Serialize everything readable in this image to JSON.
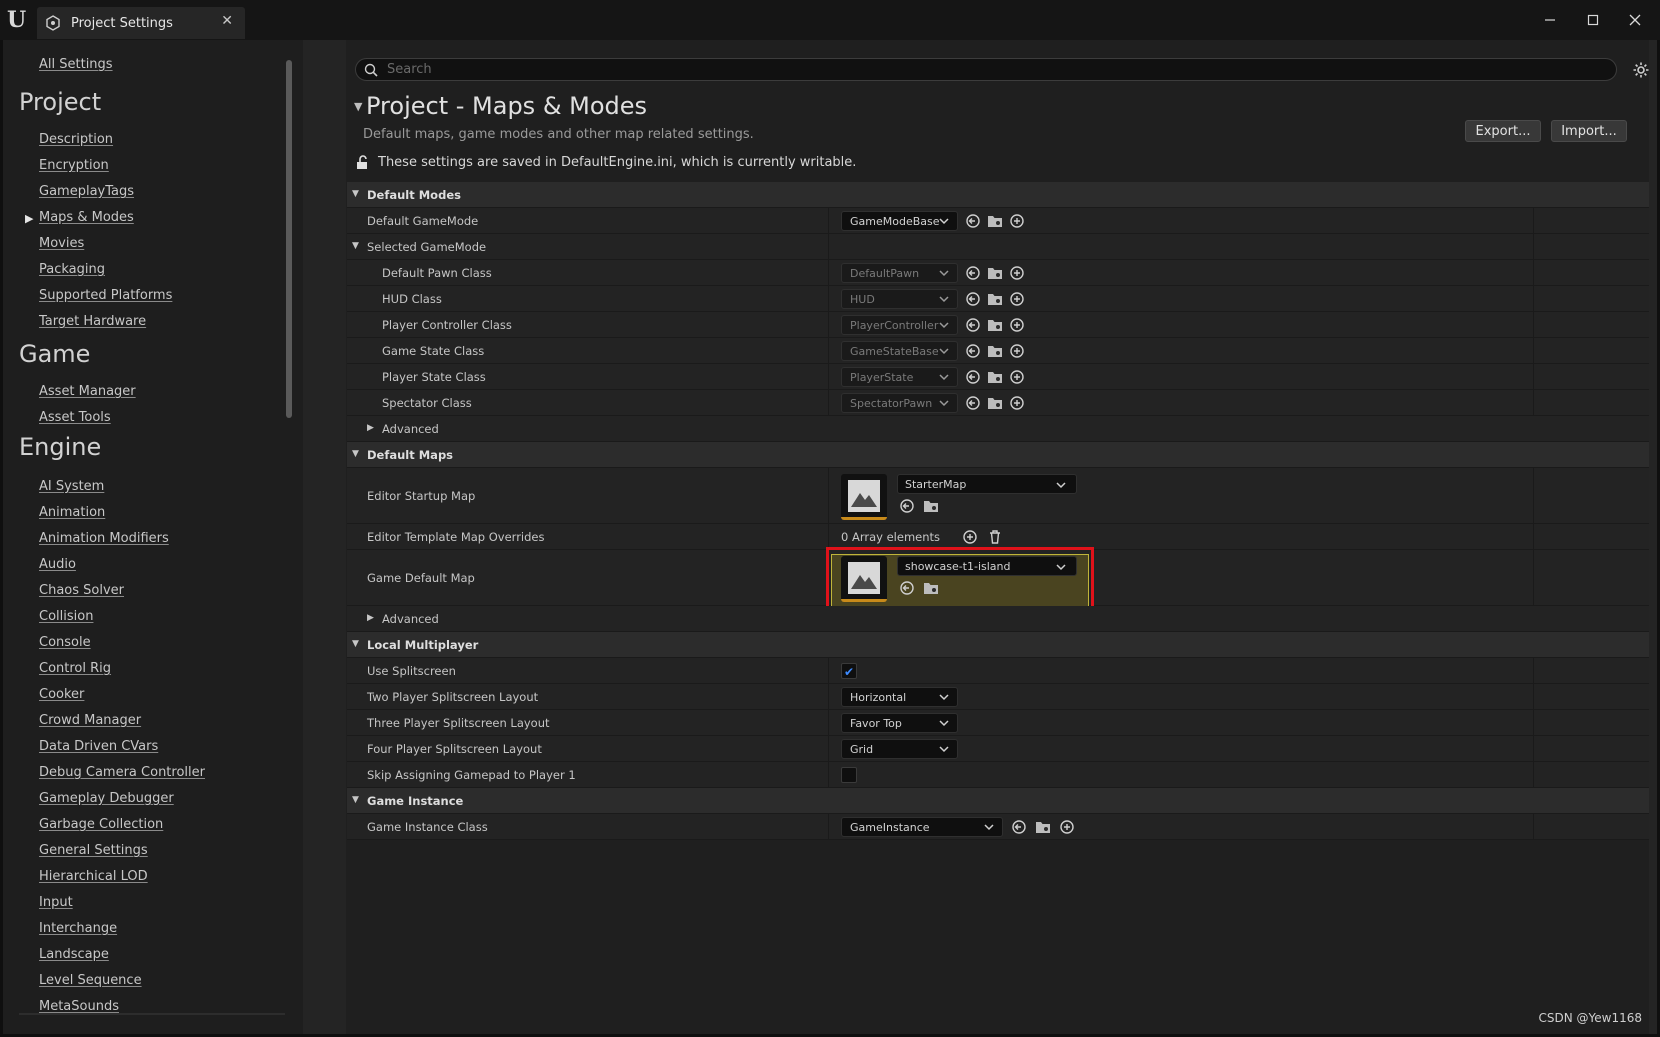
{
  "window": {
    "tab_title": "Project Settings",
    "close_glyph": "✕",
    "minimize_glyph": "—",
    "maximize_glyph": "☐",
    "window_close_glyph": "✕"
  },
  "sidebar": {
    "all_settings": "All Settings",
    "groups": [
      {
        "heading": "Project",
        "items": [
          "Description",
          "Encryption",
          "GameplayTags",
          "Maps & Modes",
          "Movies",
          "Packaging",
          "Supported Platforms",
          "Target Hardware"
        ]
      },
      {
        "heading": "Game",
        "items": [
          "Asset Manager",
          "Asset Tools"
        ]
      },
      {
        "heading": "Engine",
        "items": [
          "AI System",
          "Animation",
          "Animation Modifiers",
          "Audio",
          "Chaos Solver",
          "Collision",
          "Console",
          "Control Rig",
          "Cooker",
          "Crowd Manager",
          "Data Driven CVars",
          "Debug Camera Controller",
          "Gameplay Debugger",
          "Garbage Collection",
          "General Settings",
          "Hierarchical LOD",
          "Input",
          "Interchange",
          "Landscape",
          "Level Sequence",
          "MetaSounds"
        ]
      }
    ],
    "selected_item": "Maps & Modes"
  },
  "search": {
    "placeholder": "Search"
  },
  "page": {
    "title": "Project - Maps & Modes",
    "subtitle": "Default maps, game modes and other map related settings.",
    "export_label": "Export...",
    "import_label": "Import...",
    "save_note": "These settings are saved in DefaultEngine.ini, which is currently writable."
  },
  "default_modes": {
    "header": "Default Modes",
    "default_gamemode_label": "Default GameMode",
    "default_gamemode_value": "GameModeBase",
    "selected_gamemode_label": "Selected GameMode",
    "classes": [
      {
        "label": "Default Pawn Class",
        "value": "DefaultPawn"
      },
      {
        "label": "HUD Class",
        "value": "HUD"
      },
      {
        "label": "Player Controller Class",
        "value": "PlayerController"
      },
      {
        "label": "Game State Class",
        "value": "GameStateBase"
      },
      {
        "label": "Player State Class",
        "value": "PlayerState"
      },
      {
        "label": "Spectator Class",
        "value": "SpectatorPawn"
      }
    ],
    "advanced_label": "Advanced"
  },
  "default_maps": {
    "header": "Default Maps",
    "editor_startup_label": "Editor Startup Map",
    "editor_startup_value": "StarterMap",
    "template_overrides_label": "Editor Template Map Overrides",
    "template_overrides_value": "0 Array elements",
    "game_default_label": "Game Default Map",
    "game_default_value": "showcase-t1-island",
    "advanced_label": "Advanced"
  },
  "local_multiplayer": {
    "header": "Local Multiplayer",
    "use_splitscreen_label": "Use Splitscreen",
    "use_splitscreen_checked": true,
    "two_player_label": "Two Player Splitscreen Layout",
    "two_player_value": "Horizontal",
    "three_player_label": "Three Player Splitscreen Layout",
    "three_player_value": "Favor Top",
    "four_player_label": "Four Player Splitscreen Layout",
    "four_player_value": "Grid",
    "skip_gamepad_label": "Skip Assigning Gamepad to Player 1",
    "skip_gamepad_checked": false
  },
  "game_instance": {
    "header": "Game Instance",
    "class_label": "Game Instance Class",
    "class_value": "GameInstance"
  },
  "watermark": "CSDN @Yew1168",
  "colors": {
    "accent_highlight": "#e0121a",
    "thumb_underline": "#c88a1a",
    "check_blue": "#3d8bff"
  }
}
